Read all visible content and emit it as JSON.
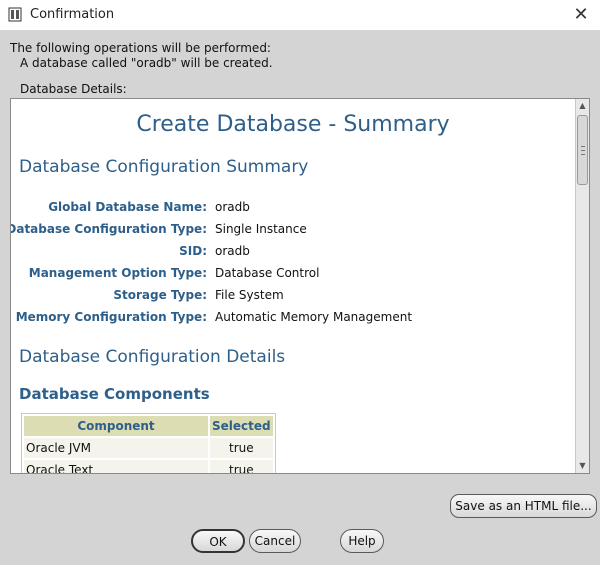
{
  "window": {
    "title": "Confirmation"
  },
  "message": {
    "line1": "The following operations will be performed:",
    "line2": "A database called \"oradb\" will be created.",
    "details_label": "Database Details:"
  },
  "summary": {
    "title": "Create Database - Summary",
    "section1": "Database Configuration Summary",
    "rows": [
      {
        "label": "Global Database Name:",
        "value": "oradb"
      },
      {
        "label": "Database Configuration Type:",
        "value": "Single Instance"
      },
      {
        "label": "SID:",
        "value": "oradb"
      },
      {
        "label": "Management Option Type:",
        "value": "Database Control"
      },
      {
        "label": "Storage Type:",
        "value": "File System"
      },
      {
        "label": "Memory Configuration Type:",
        "value": "Automatic Memory Management"
      }
    ],
    "section2": "Database Configuration Details",
    "section3": "Database Components",
    "table": {
      "headers": [
        "Component",
        "Selected"
      ],
      "rows": [
        [
          "Oracle JVM",
          "true"
        ],
        [
          "Oracle Text",
          "true"
        ]
      ]
    }
  },
  "buttons": {
    "save": "Save as an HTML file...",
    "ok": "OK",
    "cancel": "Cancel",
    "help": "Help"
  },
  "colors": {
    "heading": "#2e5f8a",
    "table_header_bg": "#ddddb4",
    "dialog_bg": "#d4d4d4"
  }
}
